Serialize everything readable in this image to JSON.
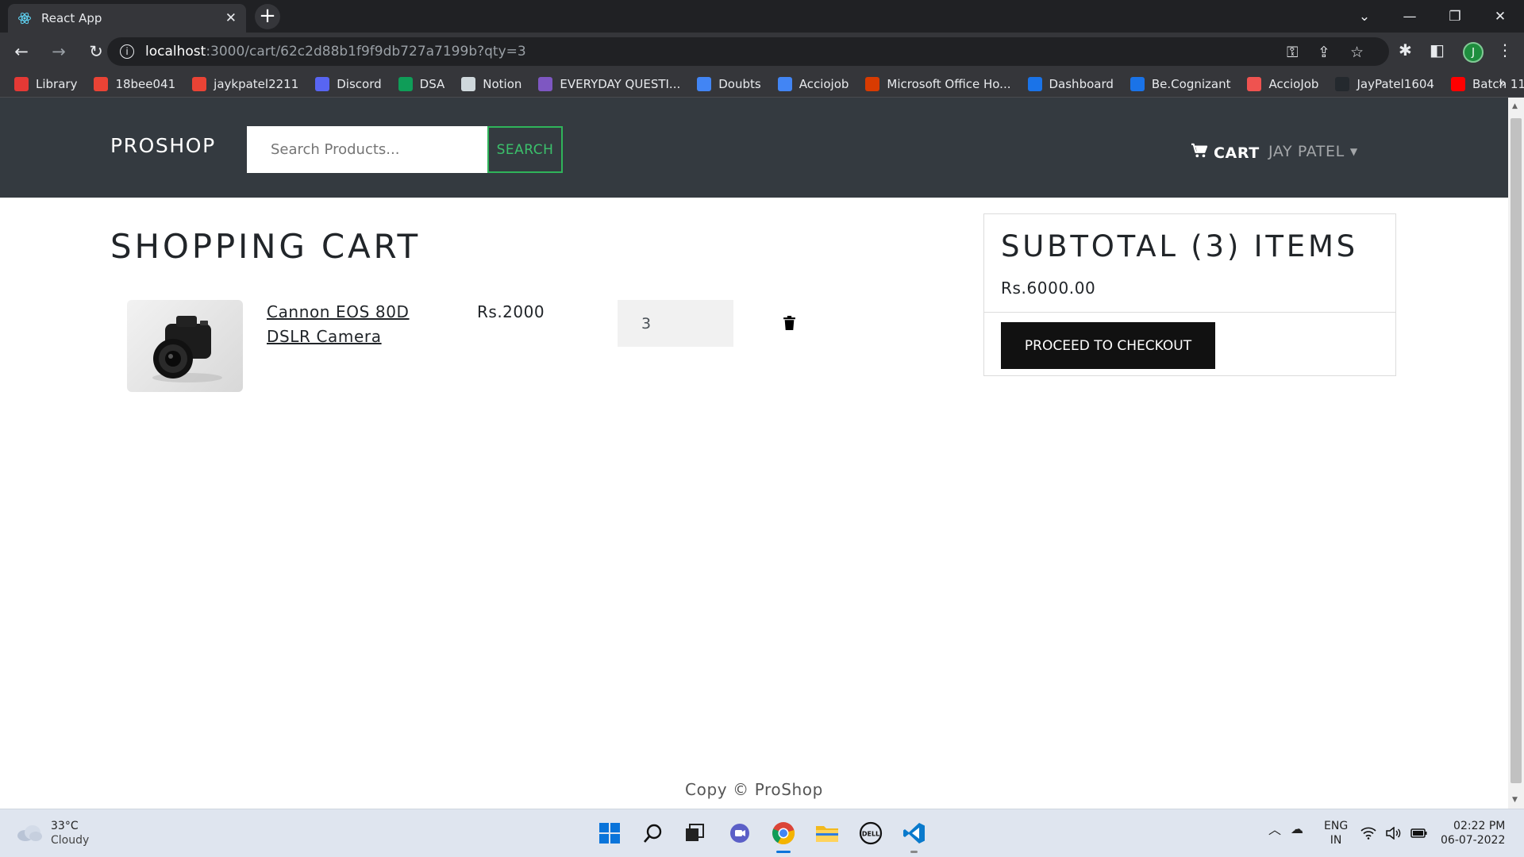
{
  "browser": {
    "tab_title": "React App",
    "url_host": "localhost",
    "url_path": ":3000/cart/62c2d88b1f9f9db727a7199b?qty=3",
    "profile_initial": "J"
  },
  "bookmarks": [
    {
      "label": "Library",
      "color": "#e53935"
    },
    {
      "label": "18bee041",
      "color": "#ea4335"
    },
    {
      "label": "jaykpatel2211",
      "color": "#ea4335"
    },
    {
      "label": "Discord",
      "color": "#5865f2"
    },
    {
      "label": "DSA",
      "color": "#0f9d58"
    },
    {
      "label": "Notion",
      "color": "#cfd8dc"
    },
    {
      "label": "EVERYDAY QUESTI...",
      "color": "#7e57c2"
    },
    {
      "label": "Doubts",
      "color": "#4285f4"
    },
    {
      "label": "Acciojob",
      "color": "#4285f4"
    },
    {
      "label": "Microsoft Office Ho...",
      "color": "#d83b01"
    },
    {
      "label": "Dashboard",
      "color": "#1a73e8"
    },
    {
      "label": "Be.Cognizant",
      "color": "#1a73e8"
    },
    {
      "label": "AccioJob",
      "color": "#ef5350"
    },
    {
      "label": "JayPatel1604",
      "color": "#24292e"
    },
    {
      "label": "Batch 11",
      "color": "#ff0000"
    }
  ],
  "nav": {
    "brand": "PROSHOP",
    "search_placeholder": "Search Products...",
    "search_button": "SEARCH",
    "cart_label": "CART",
    "user_label": "JAY PATEL"
  },
  "cart": {
    "title": "SHOPPING CART",
    "items": [
      {
        "name": "Cannon EOS 80D DSLR Camera",
        "price": "Rs.2000",
        "qty": "3"
      }
    ]
  },
  "summary": {
    "title": "SUBTOTAL (3) ITEMS",
    "amount": "Rs.6000.00",
    "checkout_label": "PROCEED TO CHECKOUT"
  },
  "footer": {
    "text": "Copy © ProShop"
  },
  "taskbar": {
    "temperature": "33°C",
    "condition": "Cloudy",
    "lang_line1": "ENG",
    "lang_line2": "IN",
    "time": "02:22 PM",
    "date": "06-07-2022"
  },
  "colors": {
    "navbar": "#343a40",
    "search_accent": "#2fb45a",
    "checkout_bg": "#111111"
  }
}
